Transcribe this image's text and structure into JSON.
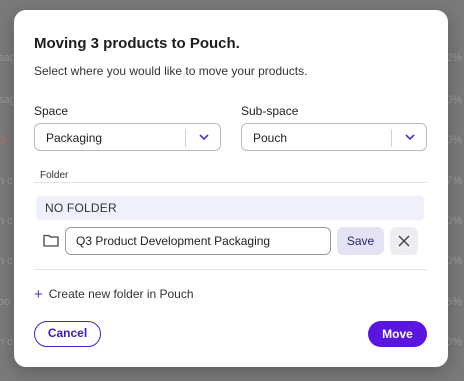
{
  "background": {
    "left_fragments": [
      "sag",
      "sag",
      "D",
      "n c",
      "n c",
      "n c",
      "oo",
      "n c"
    ],
    "right_fragments": [
      "2%",
      "00%",
      "00%",
      "7%",
      "00%",
      "00%",
      "5%",
      "00%"
    ]
  },
  "modal": {
    "title": "Moving 3 products to Pouch.",
    "subtitle": "Select where you would like to move your products.",
    "space": {
      "label": "Space",
      "value": "Packaging"
    },
    "subspace": {
      "label": "Sub-space",
      "value": "Pouch"
    },
    "folder_label": "Folder",
    "no_folder": "NO FOLDER",
    "folder_input_value": "Q3 Product Development Packaging",
    "save_label": "Save",
    "create_label": "Create new folder in Pouch",
    "cancel_label": "Cancel",
    "move_label": "Move"
  },
  "colors": {
    "accent": "#5a16e0",
    "chevron": "#5a2bd8"
  }
}
